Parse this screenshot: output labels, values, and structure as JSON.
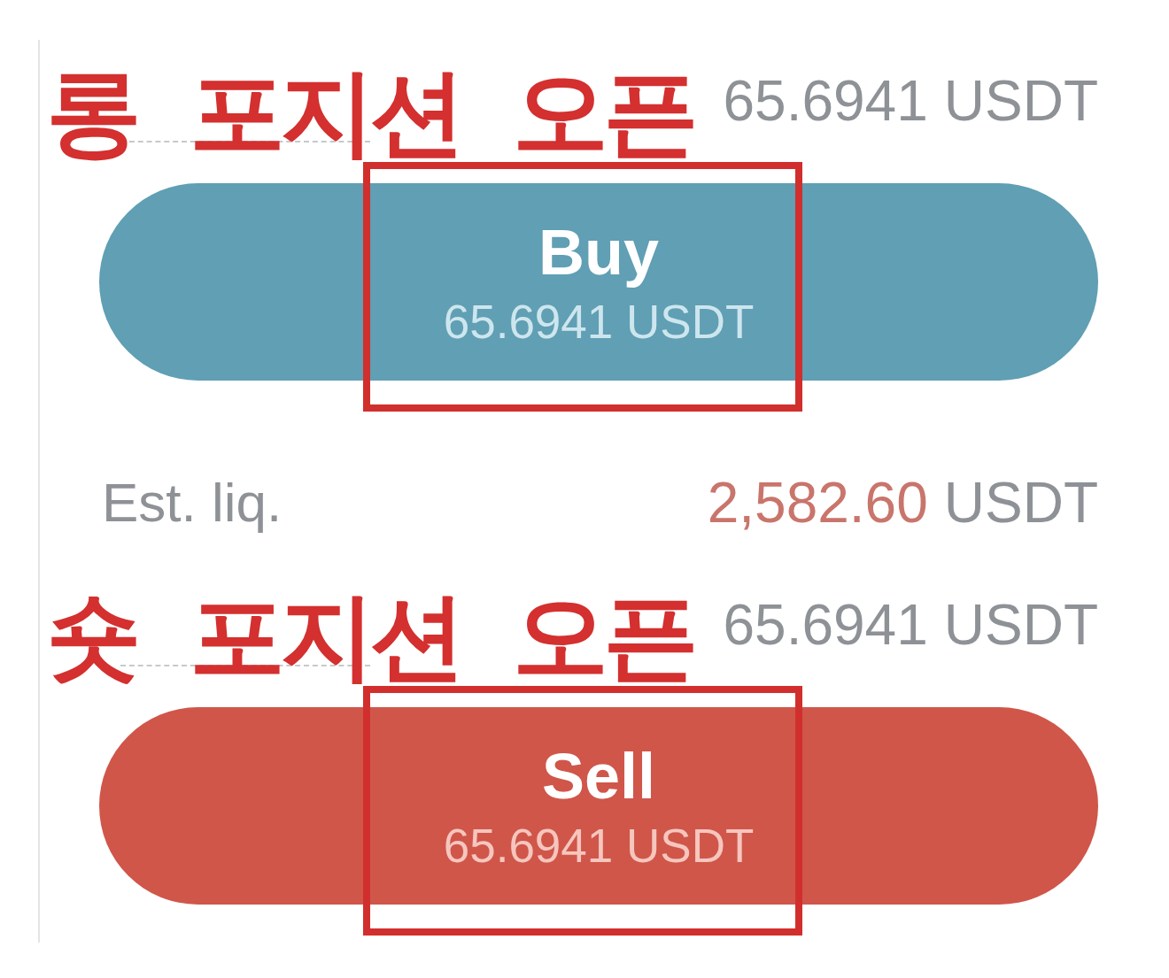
{
  "order_panel": {
    "items": [
      {
        "kind": "covered_field",
        "annotation": "롱 포지션 오픈",
        "value": "65.6941",
        "unit": "USDT"
      },
      {
        "kind": "buy",
        "label": "Buy",
        "amount": "65.6941 USDT",
        "highlighted": true
      },
      {
        "kind": "liquidation",
        "label": "Est. liq.",
        "value": "2,582.60",
        "unit": "USDT"
      },
      {
        "kind": "covered_field",
        "annotation": "숏 포지션 오픈",
        "value": "65.6941",
        "unit": "USDT"
      },
      {
        "kind": "sell",
        "label": "Sell",
        "amount": "65.6941 USDT",
        "highlighted": true
      }
    ]
  }
}
